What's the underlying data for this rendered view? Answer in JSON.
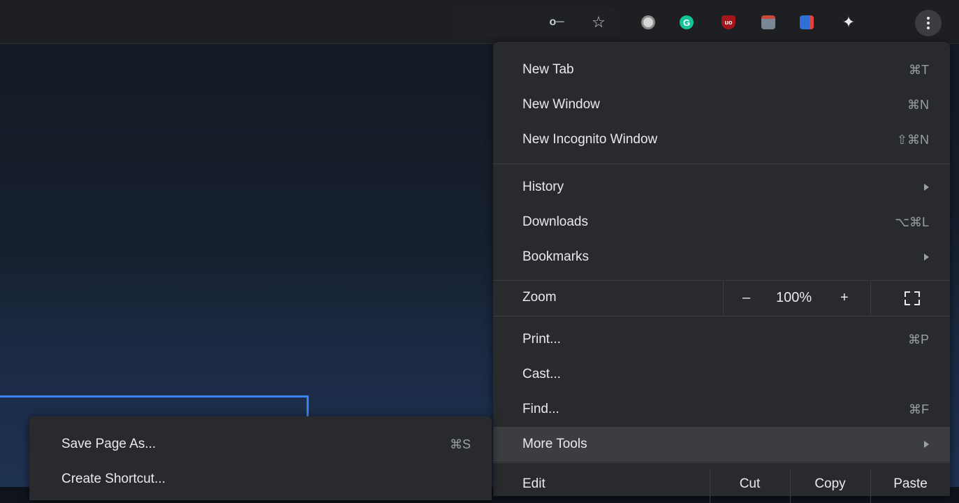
{
  "toolbar": {
    "icons": [
      "key-icon",
      "star-icon",
      "extension-circle-icon",
      "grammarly-icon",
      "ublock-icon",
      "extension-window-icon",
      "extension-blue-icon",
      "puzzle-icon",
      "menu-icon"
    ],
    "key_glyph": "o─",
    "star_glyph": "☆",
    "grammarly_glyph": "G",
    "ublock_glyph": "uo",
    "puzzle_glyph": "✦"
  },
  "menu": {
    "items": [
      {
        "label": "New Tab",
        "shortcut": "⌘T"
      },
      {
        "label": "New Window",
        "shortcut": "⌘N"
      },
      {
        "label": "New Incognito Window",
        "shortcut": "⇧⌘N"
      },
      {
        "label": "History",
        "shortcut": ""
      },
      {
        "label": "Downloads",
        "shortcut": "⌥⌘L"
      },
      {
        "label": "Bookmarks",
        "shortcut": ""
      },
      {
        "label": "Print...",
        "shortcut": "⌘P"
      },
      {
        "label": "Cast...",
        "shortcut": ""
      },
      {
        "label": "Find...",
        "shortcut": "⌘F"
      },
      {
        "label": "More Tools",
        "shortcut": ""
      }
    ],
    "zoom": {
      "label": "Zoom",
      "minus": "–",
      "value": "100%",
      "plus": "+"
    },
    "edit": {
      "label": "Edit",
      "cut": "Cut",
      "copy": "Copy",
      "paste": "Paste"
    }
  },
  "submenu": {
    "items": [
      {
        "label": "Save Page As...",
        "shortcut": "⌘S"
      },
      {
        "label": "Create Shortcut...",
        "shortcut": ""
      }
    ]
  },
  "colors": {
    "menu_bg": "#292a2d",
    "highlight": "#3c3d40",
    "accent_blue": "#3b82f6"
  }
}
